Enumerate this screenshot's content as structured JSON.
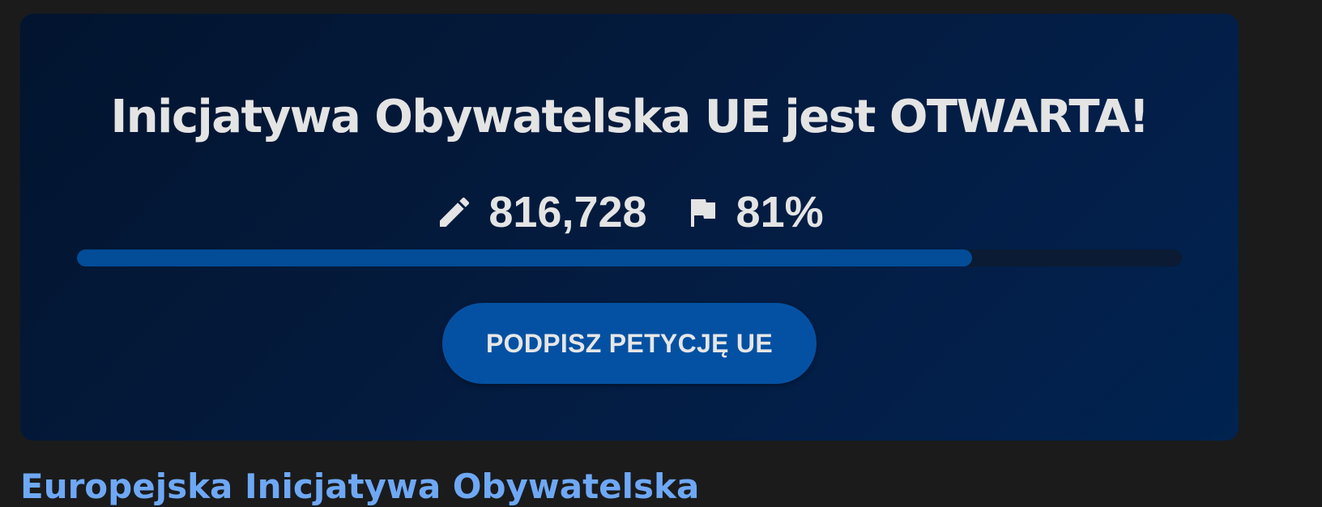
{
  "banner": {
    "title": "Inicjatywa Obywatelska UE jest OTWARTA!",
    "signatures": {
      "icon": "pencil-icon",
      "value": "816,728"
    },
    "goal": {
      "icon": "flag-icon",
      "value": "81%"
    },
    "progress": {
      "fraction": 0.81
    },
    "button_label": "PODPISZ PETYCJĘ UE"
  },
  "colors": {
    "page_background": "#1b1b1c",
    "card_background": "#031a3d",
    "accent": "#0451a3",
    "progress_fill": "#024c98",
    "text": "#e4e4e4",
    "link": "#6ea8f5"
  },
  "below": {
    "link_text": "Europejska Inicjatywa Obywatelska"
  }
}
